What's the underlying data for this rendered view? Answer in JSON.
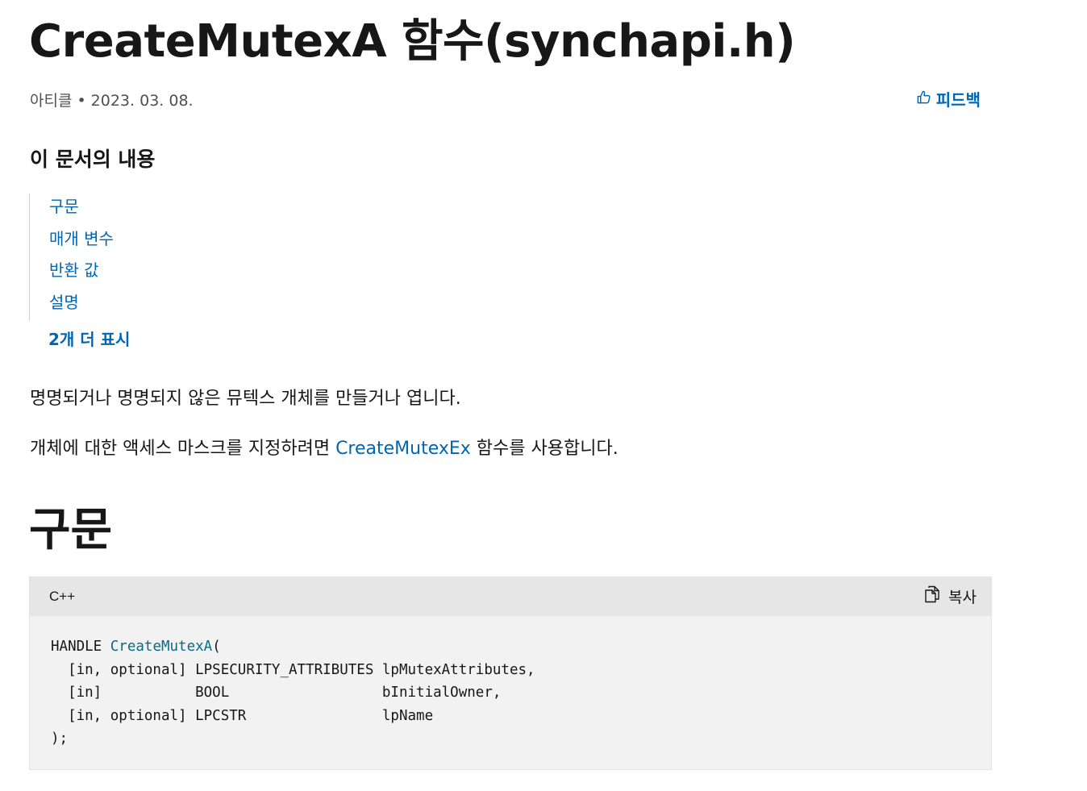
{
  "article": {
    "title": "CreateMutexA 함수(synchapi.h)",
    "type": "아티클",
    "date": "2023. 03. 08.",
    "feedback_label": "피드백"
  },
  "toc": {
    "heading": "이 문서의 내용",
    "items": [
      {
        "label": "구문"
      },
      {
        "label": "매개 변수"
      },
      {
        "label": "반환 값"
      },
      {
        "label": "설명"
      }
    ],
    "show_more": "2개 더 표시"
  },
  "intro": {
    "p1": "명명되거나 명명되지 않은 뮤텍스 개체를 만들거나 엽니다.",
    "p2_before": "개체에 대한 액세스 마스크를 지정하려면 ",
    "p2_link": "CreateMutexEx",
    "p2_after": " 함수를 사용합니다."
  },
  "syntax": {
    "heading": "구문",
    "language": "C++",
    "copy_label": "복사",
    "code": {
      "return_type": "HANDLE ",
      "function_name": "CreateMutexA",
      "open": "(",
      "lines": [
        "  [in, optional] LPSECURITY_ATTRIBUTES lpMutexAttributes,",
        "  [in]           BOOL                  bInitialOwner,",
        "  [in, optional] LPCSTR                lpName"
      ],
      "close": ");"
    }
  },
  "icons": {
    "feedback": "thumbs-up-icon",
    "copy": "copy-icon"
  },
  "colors": {
    "link": "#0065b3",
    "code_function": "#0a6a86",
    "code_background": "#f2f2f2",
    "code_header": "#e6e6e6"
  }
}
